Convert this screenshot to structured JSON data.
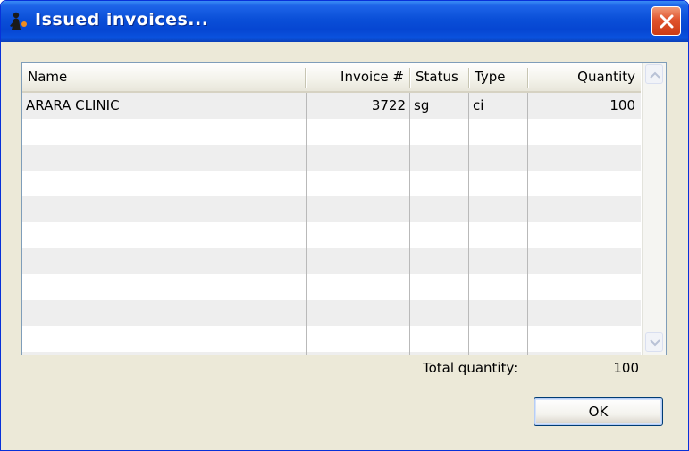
{
  "window": {
    "title": "Issued invoices...",
    "icon": "app-icon",
    "close_icon": "close-icon"
  },
  "table": {
    "columns": [
      "Name",
      "Invoice #",
      "Status",
      "Type",
      "Quantity"
    ],
    "rows": [
      {
        "name": "ARARA CLINIC",
        "invoice": "3722",
        "status": "sg",
        "type": "ci",
        "quantity": "100"
      }
    ]
  },
  "footer": {
    "total_label": "Total quantity:",
    "total_value": "100",
    "ok_label": "OK"
  },
  "colors": {
    "titlebar": "#0a4fd8",
    "dialog_bg": "#ece9d8",
    "close_button": "#e0542e",
    "alt_row": "#eeeeee"
  }
}
